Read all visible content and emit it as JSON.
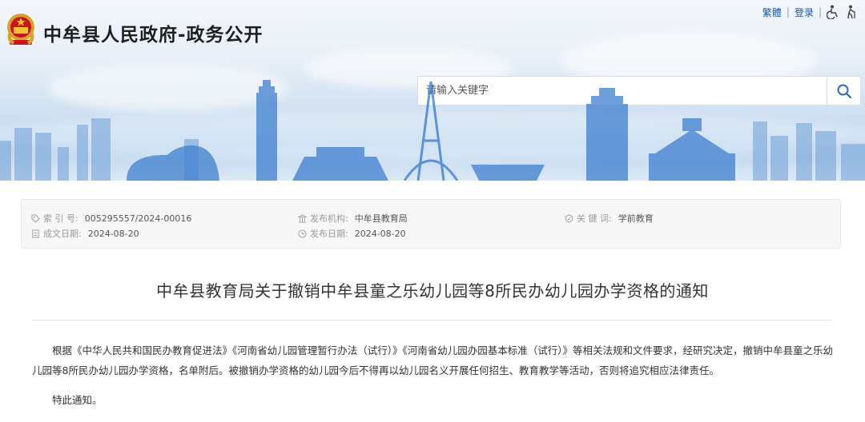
{
  "header": {
    "site_title": "中牟县人民政府-政务公开",
    "links": {
      "traditional": "繁體",
      "login": "登录"
    },
    "icons": [
      "accessibility-icon",
      "elderly-mode-icon"
    ],
    "brand_color": "#1c57a6"
  },
  "search": {
    "placeholder": "请输入关键字"
  },
  "meta": {
    "index_no": {
      "label": "索 引 号:",
      "value": "005295557/2024-00016"
    },
    "publisher": {
      "label": "发布机构:",
      "value": "中牟县教育局"
    },
    "keywords": {
      "label": "关 键 词:",
      "value": "学前教育"
    },
    "created": {
      "label": "成文日期:",
      "value": "2024-08-20"
    },
    "published": {
      "label": "发布日期:",
      "value": "2024-08-20"
    }
  },
  "document": {
    "title": "中牟县教育局关于撤销中牟县童之乐幼儿园等8所民办幼儿园办学资格的通知",
    "paragraphs": [
      "根据《中华人民共和国民办教育促进法》《河南省幼儿园管理暂行办法（试行）》《河南省幼儿园办园基本标准（试行）》等相关法规和文件要求，经研究决定，撤销中牟县童之乐幼儿园等8所民办幼儿园办学资格，名单附后。被撤销办学资格的幼儿园今后不得再以幼儿园名义开展任何招生、教育教学等活动，否则将追究相应法律责任。",
      "特此通知。"
    ]
  }
}
